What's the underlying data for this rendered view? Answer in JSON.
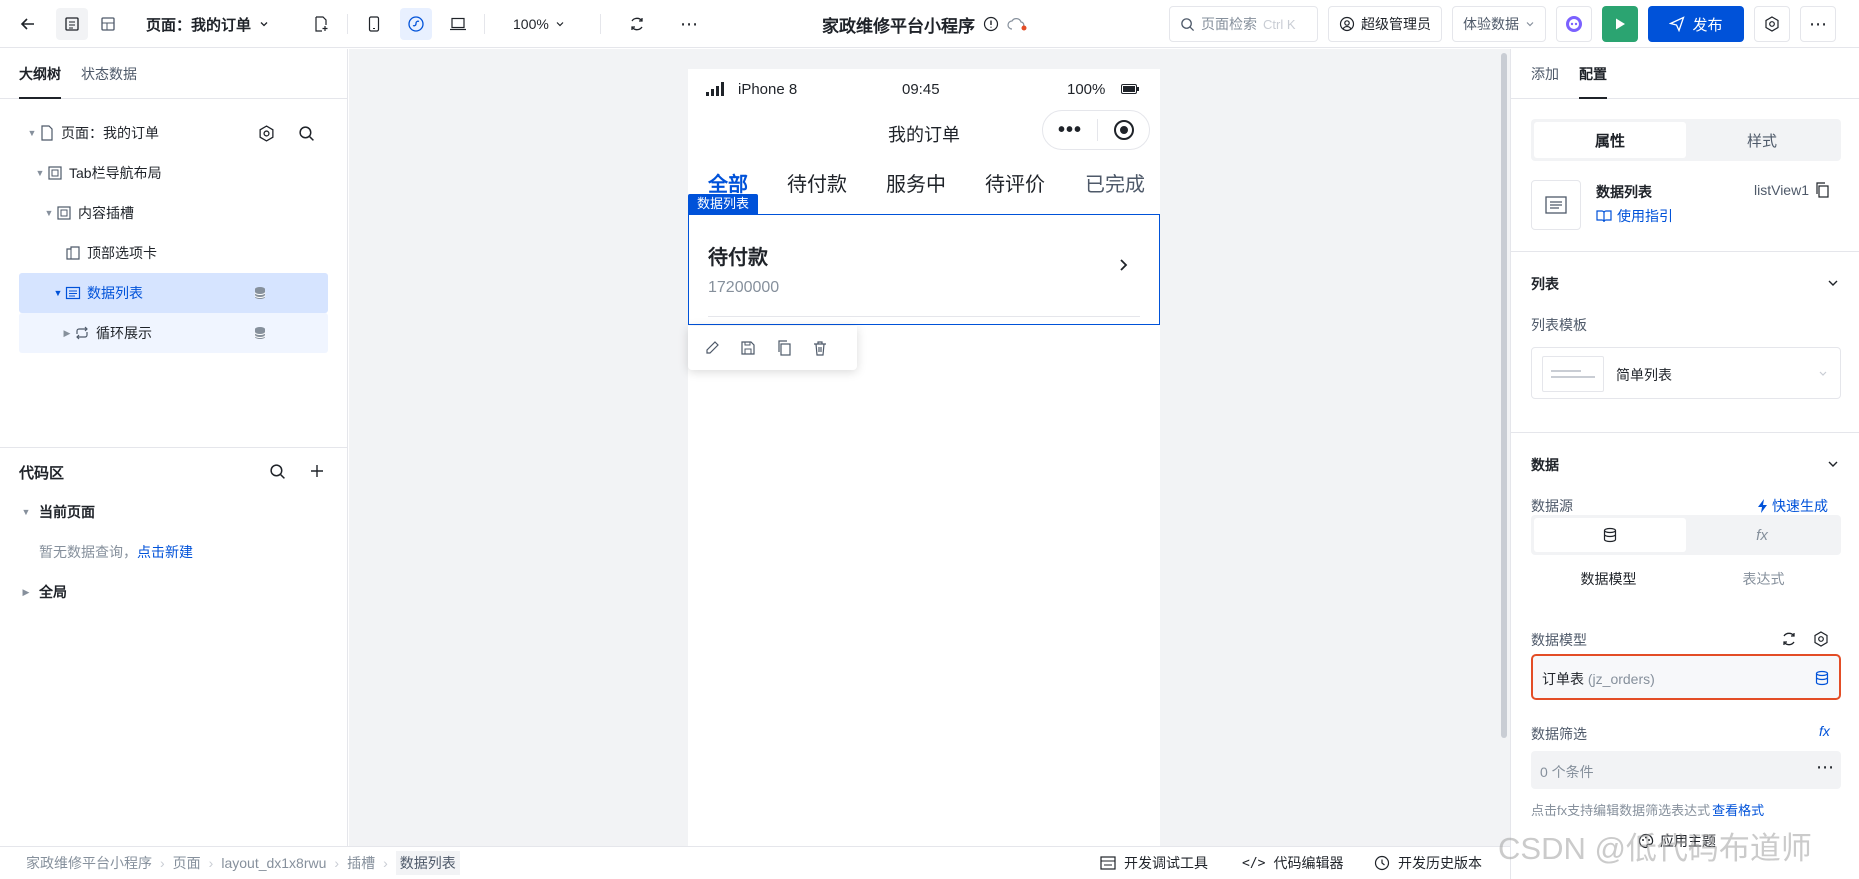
{
  "topbar": {
    "page_label": "页面：我的订单",
    "zoom": "100%",
    "app_title": "家政维修平台小程序",
    "search_placeholder": "页面检索",
    "search_shortcut": "Ctrl K",
    "admin": "超级管理员",
    "env": "体验数据",
    "publish": "发布"
  },
  "left": {
    "tabs": [
      "大纲树",
      "状态数据"
    ],
    "tree": [
      {
        "label": "页面：我的订单"
      },
      {
        "label": "Tab栏导航布局"
      },
      {
        "label": "内容插槽"
      },
      {
        "label": "顶部选项卡"
      },
      {
        "label": "数据列表"
      },
      {
        "label": "循环展示"
      }
    ],
    "code_title": "代码区",
    "current_page": "当前页面",
    "no_query": "暂无数据查询，",
    "create_link": "点击新建",
    "global": "全局"
  },
  "phone": {
    "carrier": "iPhone 8",
    "time": "09:45",
    "battery": "100%",
    "nav_title": "我的订单",
    "tabs": [
      "全部",
      "待付款",
      "服务中",
      "待评价",
      "已完成"
    ],
    "selected_label": "数据列表",
    "item_title": "待付款",
    "item_sub": "17200000"
  },
  "right": {
    "tabs": [
      "添加",
      "配置"
    ],
    "seg": [
      "属性",
      "样式"
    ],
    "comp_name": "数据列表",
    "comp_id": "listView1",
    "guide": "使用指引",
    "list_title": "列表",
    "template_label": "列表模板",
    "template_value": "简单列表",
    "data_title": "数据",
    "source_label": "数据源",
    "quick_gen": "快速生成",
    "source_opts": [
      "数据模型",
      "表达式"
    ],
    "model_label": "数据模型",
    "model_value": "订单表",
    "model_code": "(jz_orders)",
    "filter_label": "数据筛选",
    "filter_value": "0 个条件",
    "hint": "点击fx支持编辑数据筛选表达式",
    "hint_link": "查看格式",
    "apply_theme": "应用主题"
  },
  "bottom": {
    "crumbs": [
      "家政维修平台小程序",
      "页面",
      "layout_dx1x8rwu",
      "插槽",
      "数据列表"
    ],
    "debug": "开发调试工具",
    "code_editor": "代码编辑器",
    "history": "开发历史版本"
  },
  "watermark": "CSDN @低代码布道师",
  "colors": {
    "primary": "#0052d9",
    "accent_red": "#e34d26",
    "green": "#2ba471"
  }
}
